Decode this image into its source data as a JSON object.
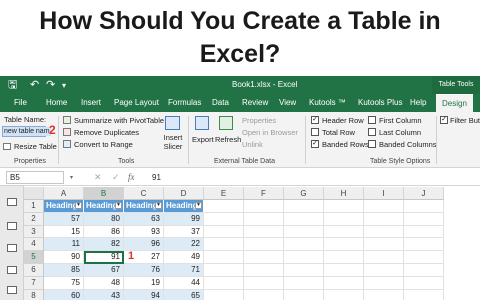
{
  "headline": "How Should You Create a Table in Excel?",
  "window": {
    "title": "Book1.xlsx  -  Excel",
    "context_tab": "Table Tools"
  },
  "tabs": [
    "File",
    "Home",
    "Insert",
    "Page Layout",
    "Formulas",
    "Data",
    "Review",
    "View",
    "Kutools ™",
    "Kutools Plus",
    "Help",
    "Design"
  ],
  "ribbon": {
    "table_name_label": "Table Name:",
    "table_name_value": "new table nam",
    "resize_table": "Resize Table",
    "properties_group": "Properties",
    "summarize_pivot": "Summarize with PivotTable",
    "remove_duplicates": "Remove Duplicates",
    "convert_range": "Convert to Range",
    "tools_group": "Tools",
    "insert_slicer": "Insert Slicer",
    "export": "Export",
    "refresh": "Refresh",
    "properties": "Properties",
    "open_browser": "Open in Browser",
    "unlink": "Unlink",
    "external_group": "External Table Data",
    "header_row": "Header Row",
    "total_row": "Total Row",
    "banded_rows": "Banded Rows",
    "first_column": "First Column",
    "last_column": "Last Column",
    "banded_columns": "Banded Columns",
    "filter_button": "Filter Butto",
    "style_options_group": "Table Style Options",
    "check_header_row": true,
    "check_total_row": false,
    "check_banded_rows": true,
    "check_first_column": false,
    "check_last_column": false,
    "check_banded_columns": false,
    "check_filter_button": true
  },
  "callouts": {
    "name_box_step": "2",
    "cell_step": "1"
  },
  "formula_bar": {
    "name_box": "B5",
    "cancel": "✕",
    "enter": "✓",
    "fx": "fx",
    "value": "91"
  },
  "columns": [
    "A",
    "B",
    "C",
    "D",
    "E",
    "F",
    "G",
    "H",
    "I",
    "J"
  ],
  "rows": [
    "1",
    "2",
    "3",
    "4",
    "5",
    "6",
    "7",
    "8"
  ],
  "table": {
    "headers": [
      "Heading",
      "Heading",
      "Heading",
      "Heading"
    ],
    "data": [
      [
        "57",
        "80",
        "63",
        "99"
      ],
      [
        "15",
        "86",
        "93",
        "37"
      ],
      [
        "11",
        "82",
        "96",
        "22"
      ],
      [
        "90",
        "91",
        "27",
        "49"
      ],
      [
        "85",
        "67",
        "76",
        "71"
      ],
      [
        "75",
        "48",
        "19",
        "44"
      ],
      [
        "60",
        "43",
        "94",
        "65"
      ]
    ]
  },
  "colors": {
    "excel_green": "#217346",
    "header_blue": "#5b9bd5",
    "band_blue": "#ddebf7",
    "callout_red": "#e1322a"
  }
}
